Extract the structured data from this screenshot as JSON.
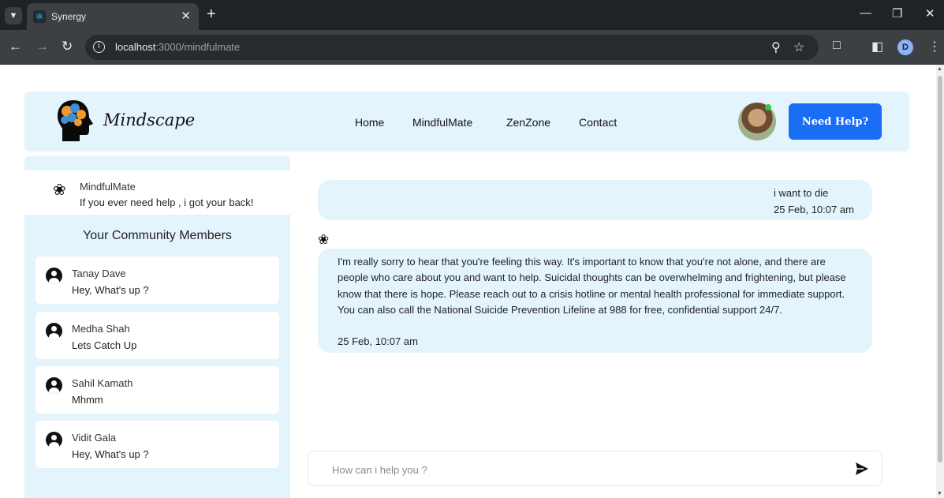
{
  "browser": {
    "tab_title": "Synergy",
    "url_host": "localhost",
    "url_path": ":3000/mindfulmate",
    "profile_initial": "D"
  },
  "header": {
    "logo_text": "Mindscape",
    "nav": [
      "Home",
      "MindfulMate",
      "ZenZone",
      "Contact"
    ],
    "help_button": "Need Help?"
  },
  "sidebar": {
    "bot": {
      "name": "MindfulMate",
      "message": "If you ever need help , i got your back!"
    },
    "community_title": "Your Community Members",
    "members": [
      {
        "name": "Tanay Dave",
        "message": "Hey, What's up ?"
      },
      {
        "name": "Medha Shah",
        "message": "Lets Catch Up"
      },
      {
        "name": "Sahil Kamath",
        "message": "Mhmm"
      },
      {
        "name": "Vidit Gala",
        "message": "Hey, What's up ?"
      }
    ]
  },
  "chat": {
    "messages": [
      {
        "sender": "user",
        "text": "i want to die",
        "time": "25 Feb, 10:07 am"
      },
      {
        "sender": "bot",
        "text": "I'm really sorry to hear that you're feeling this way. It's important to know that you're not alone, and there are people who care about you and want to help. Suicidal thoughts can be overwhelming and frightening, but please know that there is hope. Please reach out to a crisis hotline or mental health professional for immediate support. You can also call the National Suicide Prevention Lifeline at 988 for free, confidential support 24/7.",
        "time": "25 Feb, 10:07 am"
      }
    ],
    "input_placeholder": "How can i help you ?"
  },
  "colors": {
    "accent": "#1a6ef5",
    "panel_bg": "#e4f4fd",
    "chrome_dark": "#1f2327",
    "chrome_toolbar": "#3c4043"
  },
  "icons": {
    "bot": "pinwheel-icon",
    "member": "user-circle-icon",
    "send": "send-icon"
  }
}
